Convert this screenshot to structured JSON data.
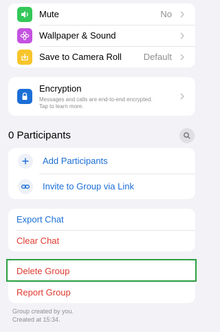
{
  "settings": [
    {
      "label": "Mute",
      "value": "No",
      "icon": "speaker-icon",
      "color": "#34c759"
    },
    {
      "label": "Wallpaper & Sound",
      "value": "",
      "icon": "flower-icon",
      "color": "#c452e0"
    },
    {
      "label": "Save to Camera Roll",
      "value": "Default",
      "icon": "download-icon",
      "color": "#f7c52b"
    }
  ],
  "encryption": {
    "title": "Encryption",
    "subtitle_line1": "Messages and calls are end-to-end encrypted.",
    "subtitle_line2": "Tap to learn more.",
    "color": "#1b6fd6"
  },
  "participants": {
    "title": "0 Participants",
    "items": [
      {
        "label": "Add Participants"
      },
      {
        "label": "Invite to Group via Link"
      }
    ]
  },
  "chat_actions": [
    {
      "label": "Export Chat"
    },
    {
      "label": "Clear Chat"
    }
  ],
  "group_actions": [
    {
      "label": "Delete Group"
    },
    {
      "label": "Report Group"
    }
  ],
  "footer": {
    "line1": "Group created by you.",
    "line2": "Created at 15:34."
  }
}
